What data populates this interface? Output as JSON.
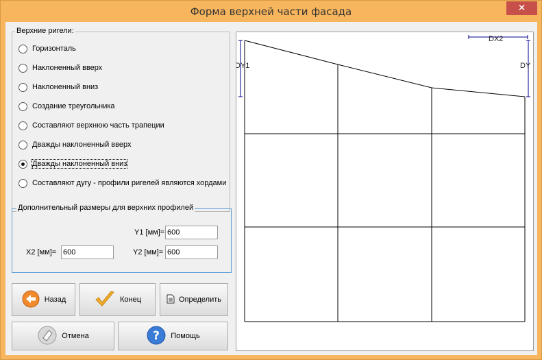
{
  "window": {
    "title": "Форма верхней части фасада",
    "close_glyph": "✕"
  },
  "rails_group": {
    "label": "Верхние ригели:",
    "options": [
      {
        "label": "Горизонталь",
        "checked": false
      },
      {
        "label": "Наклоненный вверх",
        "checked": false
      },
      {
        "label": "Наклоненный вниз",
        "checked": false
      },
      {
        "label": "Создание треугольника",
        "checked": false
      },
      {
        "label": "Составляют верхнюю часть трапеции",
        "checked": false
      },
      {
        "label": "Дважды наклоненный вверх",
        "checked": false
      },
      {
        "label": "Дважды наклоненный вниз",
        "checked": true
      },
      {
        "label": "Составляют дугу - профили ригелей являются хордами",
        "checked": false
      }
    ]
  },
  "dims_group": {
    "label": "Дополнительный размеры для верхних профилей",
    "y1_label": "Y1 [мм]=",
    "y1_value": "600",
    "x2_label": "X2 [мм]=",
    "x2_value": "600",
    "y2_label": "Y2 [мм]=",
    "y2_value": "600"
  },
  "buttons": {
    "back": "Назад",
    "finish": "Конец",
    "define": "Определить",
    "cancel": "Отмена",
    "help": "Помощь"
  },
  "icons": {
    "back": "arrow-left-icon",
    "finish": "checkmark-icon",
    "define": "document-icon",
    "cancel": "eraser-icon",
    "help": "help-icon"
  },
  "drawing": {
    "dy1_label": "DY1",
    "dx2_label": "DX2",
    "dy_label": "DY",
    "line_color": "#000000",
    "dim_color": "#00008b"
  }
}
